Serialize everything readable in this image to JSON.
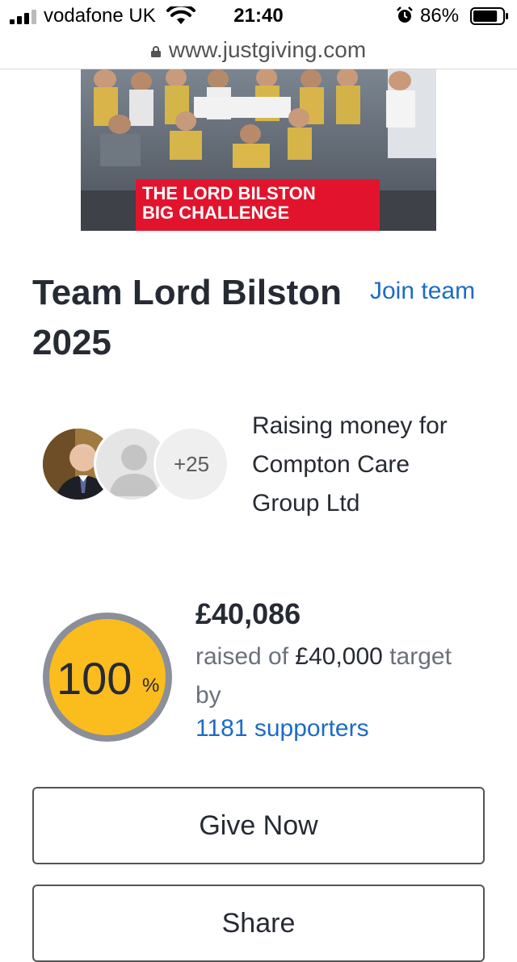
{
  "status_bar": {
    "carrier": "vodafone UK",
    "time": "21:40",
    "battery_percent": "86%",
    "battery_level": 0.86
  },
  "browser": {
    "url": "www.justgiving.com"
  },
  "hero": {
    "banner_line1": "THE LORD BILSTON",
    "banner_line2": "BIG CHALLENGE"
  },
  "team": {
    "title_line1": "Team Lord Bilston",
    "title_line2": "2025",
    "join_label": "Join team"
  },
  "members": {
    "extra_count": "+25"
  },
  "charity": {
    "line1": "Raising money for",
    "line2": "Compton Care",
    "line3": "Group Ltd"
  },
  "fundraising": {
    "percent": "100",
    "percent_sign": "%",
    "progress_fraction": 1.0,
    "amount_raised": "£40,086",
    "raised_prefix": "raised of",
    "target": "£40,000",
    "target_suffix": "target",
    "by_label": "by",
    "supporters": "1181 supporters",
    "ring_color": "#8a8f99",
    "fill_color": "#fbbc1e"
  },
  "actions": {
    "give_now": "Give Now",
    "share": "Share"
  }
}
